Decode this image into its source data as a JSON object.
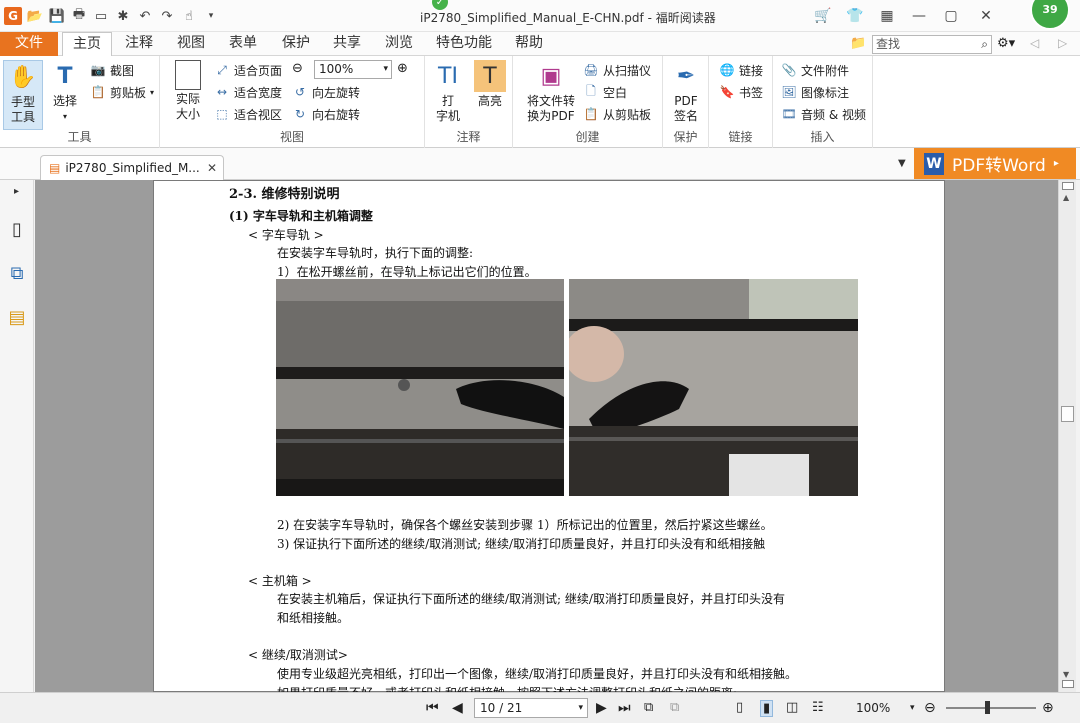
{
  "window": {
    "title": "iP2780_Simplified_Manual_E-CHN.pdf - 福昕阅读器",
    "badge_count": "39"
  },
  "menu": {
    "file": "文件",
    "tabs": [
      "主页",
      "注释",
      "视图",
      "表单",
      "保护",
      "共享",
      "浏览",
      "特色功能",
      "帮助"
    ],
    "search_placeholder": "查找"
  },
  "ribbon": {
    "tools": {
      "hand": "手型\n工具",
      "hand_l1": "手型",
      "hand_l2": "工具",
      "select": "选择",
      "screenshot": "截图",
      "clipboard": "剪贴板",
      "label": "工具"
    },
    "view": {
      "actual_l1": "实际",
      "actual_l2": "大小",
      "fit_page": "适合页面",
      "fit_width": "适合宽度",
      "fit_visible": "适合视区",
      "zoom_value": "100%",
      "rotate_left": "向左旋转",
      "rotate_right": "向右旋转",
      "label": "视图"
    },
    "comment": {
      "typewriter_l1": "打",
      "typewriter_l2": "字机",
      "highlight": "高亮",
      "label": "注释"
    },
    "create": {
      "convert_l1": "将文件转",
      "convert_l2": "换为PDF",
      "from_scanner": "从扫描仪",
      "blank": "空白",
      "from_clipboard": "从剪贴板",
      "label": "创建"
    },
    "protect": {
      "sign_l1": "PDF",
      "sign_l2": "签名",
      "label": "保护"
    },
    "links": {
      "link": "链接",
      "bookmark": "书签",
      "label": "链接"
    },
    "insert": {
      "attachment": "文件附件",
      "image_annot": "图像标注",
      "audio_video": "音频 & 视频",
      "label": "插入"
    }
  },
  "doc_tab": {
    "name": "iP2780_Simplified_M...",
    "pdf_to_word": "PDF转Word"
  },
  "page": {
    "section": "2-3.   维修特别说明",
    "sub": "(1)   字车导轨和主机箱调整",
    "rail_title": "< 字车导轨 >",
    "rail_intro": "在安装字车导轨时，执行下面的调整:",
    "rail_step1": "1）在松开螺丝前，在导轨上标记出它们的位置。",
    "rail_step2": "2)    在安装字车导轨时，确保各个螺丝安装到步骤 1）所标记出的位置里，然后拧紧这些螺丝。",
    "rail_step3": "3)    保证执行下面所述的继续/取消测试; 继续/取消打印质量良好，并且打印头没有和纸相接触",
    "box_title": "< 主机箱 >",
    "box_line1": "在安装主机箱后，保证执行下面所述的继续/取消测试; 继续/取消打印质量良好，并且打印头没有",
    "box_line2": "和纸相接触。",
    "test_title": "< 继续/取消测试>",
    "test_line1": "使用专业级超光亮相纸，打印出一个图像，继续/取消打印质量良好，并且打印头没有和纸相接触。",
    "test_line2": "如果打印质量不好，或者打印头和纸相接触，按照下述方法调整打印头和纸之间的距离:"
  },
  "status": {
    "page_display": "10 / 21",
    "zoom": "100%",
    "zoom_fraction": 0.45
  },
  "colors": {
    "accent_orange": "#e8731f",
    "pdf_word_orange": "#f08a24",
    "selected_blue": "#d6e8f7"
  }
}
